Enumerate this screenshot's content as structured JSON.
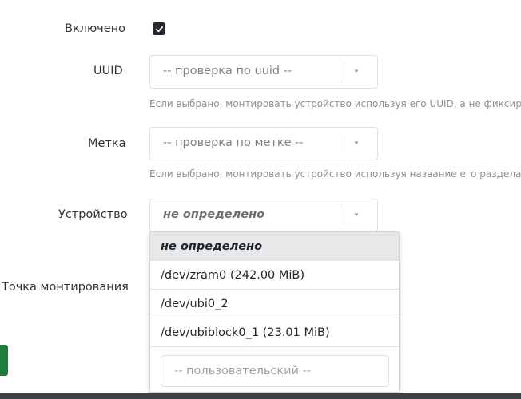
{
  "fields": {
    "enabled": {
      "label": "Включено",
      "checked": true
    },
    "uuid": {
      "label": "UUID",
      "value": "-- проверка по uuid --",
      "description": "Если выбрано, монтировать устройство используя его UUID, а не фиксир"
    },
    "label_field": {
      "label": "Метка",
      "value": "-- проверка по метке --",
      "description": "Если выбрано, монтировать устройство используя название его раздела"
    },
    "device": {
      "label": "Устройство",
      "value": "не определено",
      "options": [
        "не определено",
        "/dev/zram0 (242.00 MiB)",
        "/dev/ubi0_2",
        "/dev/ubiblock0_1 (23.01 MiB)"
      ],
      "custom_placeholder": "-- пользовательский --"
    },
    "mount_point": {
      "label": "Точка монтирования"
    }
  },
  "colors": {
    "checkbox": "#262a2e",
    "button": "#1e7d3a"
  },
  "icons": {
    "checkbox": "check-icon",
    "caret": "caret-down-icon"
  }
}
